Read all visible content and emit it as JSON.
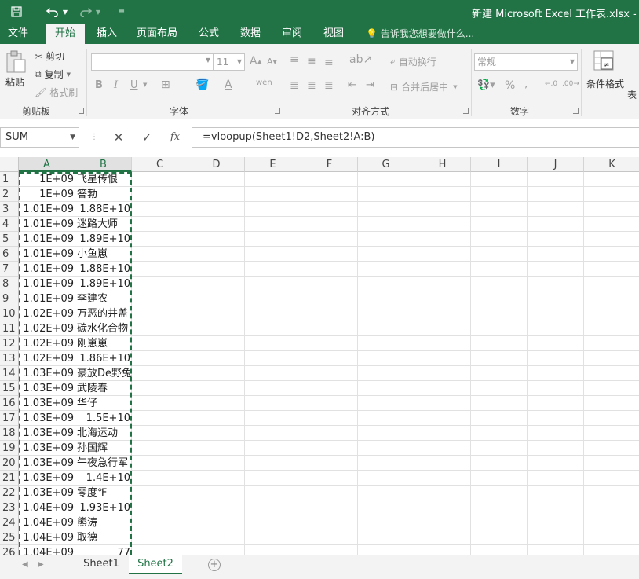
{
  "titlebar": {
    "title": "新建 Microsoft Excel 工作表.xlsx - Exc",
    "save_icon": "floppy-disk-icon",
    "undo_icon": "undo-icon",
    "redo_icon": "redo-icon"
  },
  "menu_tabs": [
    {
      "label": "文件"
    },
    {
      "label": "开始"
    },
    {
      "label": "插入"
    },
    {
      "label": "页面布局"
    },
    {
      "label": "公式"
    },
    {
      "label": "数据"
    },
    {
      "label": "审阅"
    },
    {
      "label": "视图"
    }
  ],
  "tell_me": "告诉我您想要做什么...",
  "ribbon": {
    "clipboard": {
      "paste": "粘贴",
      "cut": "剪切",
      "copy": "复制",
      "format_painter": "格式刷",
      "label": "剪贴板"
    },
    "font": {
      "size": "11",
      "bold": "B",
      "italic": "I",
      "underline": "U",
      "grow": "A",
      "shrink": "A",
      "label": "字体"
    },
    "alignment": {
      "wrap": "自动换行",
      "merge": "合并后居中",
      "label": "对齐方式"
    },
    "number": {
      "format": "常规",
      "percent": "%",
      "comma": ",",
      "label": "数字"
    },
    "styles": {
      "conditional": "条件格式",
      "table": "表"
    }
  },
  "formula_bar": {
    "name_box": "SUM",
    "cancel_icon": "✕",
    "enter_icon": "✓",
    "fx": "fx",
    "formula": "=vloopup(Sheet1!D2,Sheet2!A:B)"
  },
  "grid": {
    "columns": [
      "A",
      "B",
      "C",
      "D",
      "E",
      "F",
      "G",
      "H",
      "I",
      "J",
      "K"
    ],
    "rows": [
      {
        "n": "1",
        "a": "1E+09",
        "b": "飞星传恨",
        "b_num": false
      },
      {
        "n": "2",
        "a": "1E+09",
        "b": "答勃",
        "b_num": false
      },
      {
        "n": "3",
        "a": "1.01E+09",
        "b": "1.88E+10",
        "b_num": true
      },
      {
        "n": "4",
        "a": "1.01E+09",
        "b": "迷路大师",
        "b_num": false
      },
      {
        "n": "5",
        "a": "1.01E+09",
        "b": "1.89E+10",
        "b_num": true
      },
      {
        "n": "6",
        "a": "1.01E+09",
        "b": "小鱼崽",
        "b_num": false
      },
      {
        "n": "7",
        "a": "1.01E+09",
        "b": "1.88E+10",
        "b_num": true
      },
      {
        "n": "8",
        "a": "1.01E+09",
        "b": "1.89E+10",
        "b_num": true
      },
      {
        "n": "9",
        "a": "1.01E+09",
        "b": "李建农",
        "b_num": false
      },
      {
        "n": "10",
        "a": "1.02E+09",
        "b": "万恶的井盖",
        "b_num": false
      },
      {
        "n": "11",
        "a": "1.02E+09",
        "b": "碳水化合物",
        "b_num": false
      },
      {
        "n": "12",
        "a": "1.02E+09",
        "b": "刚崽崽",
        "b_num": false
      },
      {
        "n": "13",
        "a": "1.02E+09",
        "b": "1.86E+10",
        "b_num": true
      },
      {
        "n": "14",
        "a": "1.03E+09",
        "b": "豪放De野兔",
        "b_num": false
      },
      {
        "n": "15",
        "a": "1.03E+09",
        "b": "武陵春",
        "b_num": false
      },
      {
        "n": "16",
        "a": "1.03E+09",
        "b": "华仔",
        "b_num": false
      },
      {
        "n": "17",
        "a": "1.03E+09",
        "b": "1.5E+10",
        "b_num": true
      },
      {
        "n": "18",
        "a": "1.03E+09",
        "b": "北海运动",
        "b_num": false
      },
      {
        "n": "19",
        "a": "1.03E+09",
        "b": "孙国辉",
        "b_num": false
      },
      {
        "n": "20",
        "a": "1.03E+09",
        "b": "午夜急行军",
        "b_num": false
      },
      {
        "n": "21",
        "a": "1.03E+09",
        "b": "1.4E+10",
        "b_num": true
      },
      {
        "n": "22",
        "a": "1.03E+09",
        "b": "零度℉",
        "b_num": false
      },
      {
        "n": "23",
        "a": "1.04E+09",
        "b": "1.93E+10",
        "b_num": true
      },
      {
        "n": "24",
        "a": "1.04E+09",
        "b": "熊涛",
        "b_num": false
      },
      {
        "n": "25",
        "a": "1.04E+09",
        "b": "取德",
        "b_num": false
      },
      {
        "n": "26",
        "a": "1.04E+09",
        "b": "77",
        "b_num": true
      }
    ]
  },
  "sheets": [
    {
      "name": "Sheet1",
      "active": false
    },
    {
      "name": "Sheet2",
      "active": true
    }
  ],
  "colors": {
    "accent": "#217346",
    "ribbon_bg": "#f3f3f3",
    "marquee": "#217346"
  }
}
